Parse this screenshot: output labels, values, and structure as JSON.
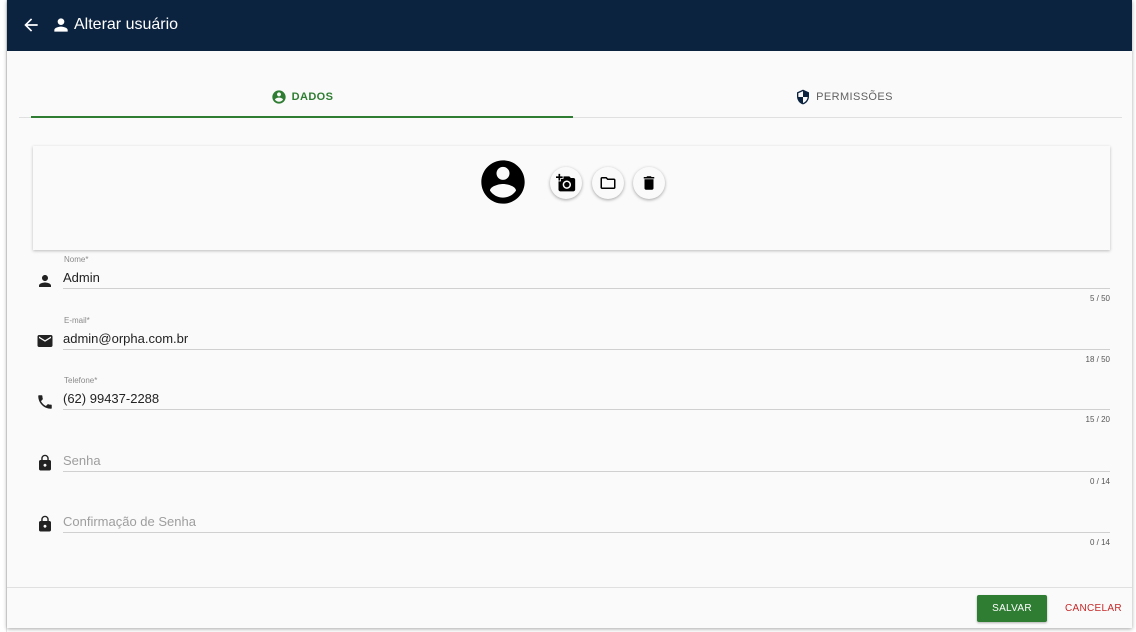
{
  "header": {
    "title": "Alterar usuário",
    "back_icon": "arrow-back-icon",
    "user_icon": "person-icon",
    "background": "#0c2340"
  },
  "tabs": [
    {
      "label": "DADOS",
      "icon": "account-circle-icon",
      "active": true
    },
    {
      "label": "PERMISSÕES",
      "icon": "shield-icon",
      "active": false
    }
  ],
  "photo": {
    "avatar_icon": "account-circle-icon",
    "actions": [
      {
        "icon": "add-a-photo-icon"
      },
      {
        "icon": "folder-icon"
      },
      {
        "icon": "delete-icon"
      }
    ]
  },
  "fields": {
    "nome": {
      "label": "Nome",
      "required": "*",
      "value": "Admin",
      "placeholder": "",
      "counter": "5 / 50",
      "icon": "person-icon"
    },
    "email": {
      "label": "E-mail",
      "required": "*",
      "value": "admin@orpha.com.br",
      "placeholder": "",
      "counter": "18 / 50",
      "icon": "mail-icon"
    },
    "telefone": {
      "label": "Telefone",
      "required": "*",
      "value": "(62) 99437-2288",
      "placeholder": "",
      "counter": "15 / 20",
      "icon": "phone-icon"
    },
    "senha": {
      "label": "",
      "value": "",
      "placeholder": "Senha",
      "counter": "0 / 14",
      "icon": "lock-icon"
    },
    "confirmacao": {
      "label": "",
      "value": "",
      "placeholder": "Confirmação de Senha",
      "counter": "0 / 14",
      "icon": "lock-icon"
    }
  },
  "footer": {
    "save_label": "SALVAR",
    "cancel_label": "CANCELAR"
  },
  "colors": {
    "accent": "#2e7d32",
    "danger": "#c62828",
    "header": "#0c2340"
  }
}
